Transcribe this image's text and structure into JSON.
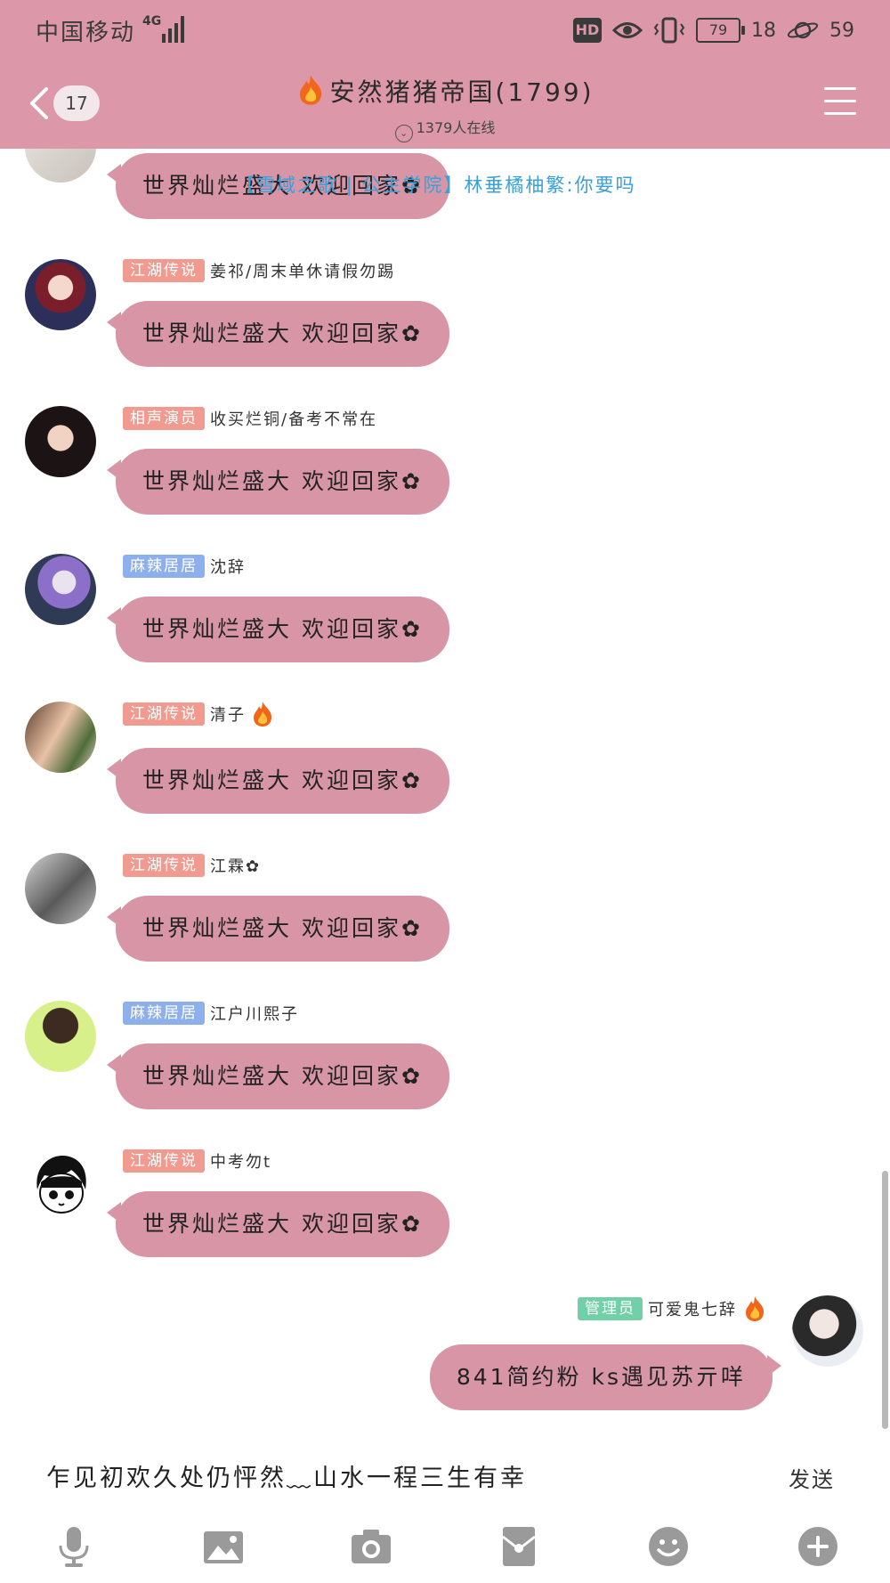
{
  "status_bar": {
    "carrier": "中国移动",
    "network": "4G",
    "hd": "HD",
    "battery": "79",
    "data_speed": "18",
    "signal_value": "59"
  },
  "header": {
    "unread_count": "17",
    "title": "安然猪猪帝国(1799)",
    "online_text": "1379人在线"
  },
  "notice_text": "【雪域之歌 | 公主学院】林垂橘柚繁:你要吗",
  "messages": [
    {
      "badge": "",
      "name": "",
      "text": "世界灿烂盛大 欢迎回家✿"
    },
    {
      "badge": "江湖传说",
      "name": "姜祁/周末单休请假勿踢",
      "text": "世界灿烂盛大 欢迎回家✿"
    },
    {
      "badge": "相声演员",
      "name": "收买烂铜/备考不常在",
      "text": "世界灿烂盛大 欢迎回家✿"
    },
    {
      "badge": "麻辣居居",
      "name": "沈辞",
      "text": "世界灿烂盛大 欢迎回家✿"
    },
    {
      "badge": "江湖传说",
      "name": "清子",
      "text": "世界灿烂盛大 欢迎回家✿"
    },
    {
      "badge": "江湖传说",
      "name": "江霖✿",
      "text": "世界灿烂盛大 欢迎回家✿"
    },
    {
      "badge": "麻辣居居",
      "name": "江户川熙子",
      "text": "世界灿烂盛大 欢迎回家✿"
    },
    {
      "badge": "江湖传说",
      "name": "中考勿t",
      "text": "世界灿烂盛大 欢迎回家✿"
    }
  ],
  "my_message": {
    "badge": "管理员",
    "name": "可爱鬼七辞",
    "text": "841简约粉 ks遇见苏亓咩"
  },
  "input": {
    "value": "乍见初欢久处仍怦然﹏山水一程三生有幸",
    "send_label": "发送"
  },
  "toolbar_icons": [
    "microphone-icon",
    "image-icon",
    "camera-icon",
    "red-packet-icon",
    "emoji-icon",
    "plus-icon"
  ],
  "colors": {
    "header_bg": "#dc98a8",
    "bubble": "#d795a6",
    "badge_jianghu": "#f19a8f",
    "badge_xiangsheng": "#f19a8f",
    "badge_mala": "#8db0ec",
    "badge_admin": "#72d0a8",
    "notice": "#3aa0d9",
    "icon_gray": "#9a9a9a"
  }
}
